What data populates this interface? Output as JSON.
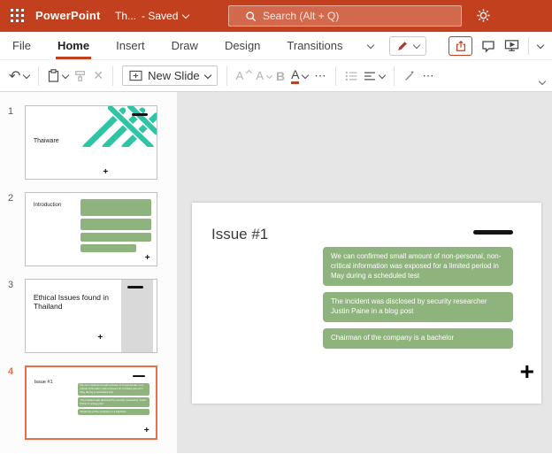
{
  "topbar": {
    "app_name": "PowerPoint",
    "document_title": "Th...",
    "save_status": "- Saved",
    "search_placeholder": "Search (Alt + Q)"
  },
  "menubar": {
    "items": [
      "File",
      "Home",
      "Insert",
      "Draw",
      "Design",
      "Transitions"
    ],
    "active_item": "Home"
  },
  "toolbar": {
    "undo_glyph": "↶",
    "delete_glyph": "✕",
    "new_slide_label": "New Slide",
    "increase_font_label": "A",
    "decrease_font_label": "A",
    "bold_label": "B",
    "font_color_label": "A",
    "more_label": "⋯"
  },
  "slide_panel": {
    "slides": [
      {
        "number": "1",
        "title": "Thaiware"
      },
      {
        "number": "2",
        "title": "Introduction"
      },
      {
        "number": "3",
        "title": "Ethical Issues found in Thailand"
      },
      {
        "number": "4",
        "title": "Issue #1"
      }
    ],
    "selected_slide": "4"
  },
  "editor": {
    "slide_title": "Issue #1",
    "text_boxes": [
      "We can confirmed small amount of non-personal, non-critical information was exposed for a limited period in May during a scheduled test",
      "The incident was disclosed by security researcher Justin Paine in a blog post",
      "Chairman of the company is a bachelor"
    ]
  },
  "colors": {
    "brand_red": "#C3401F",
    "selection_orange": "#ED6C47",
    "box_green": "#8FB37C",
    "pattern_teal": "#2EC4A5",
    "canvas_gray": "#E7E6E6",
    "thumb_gray": "#D9D9D9"
  }
}
